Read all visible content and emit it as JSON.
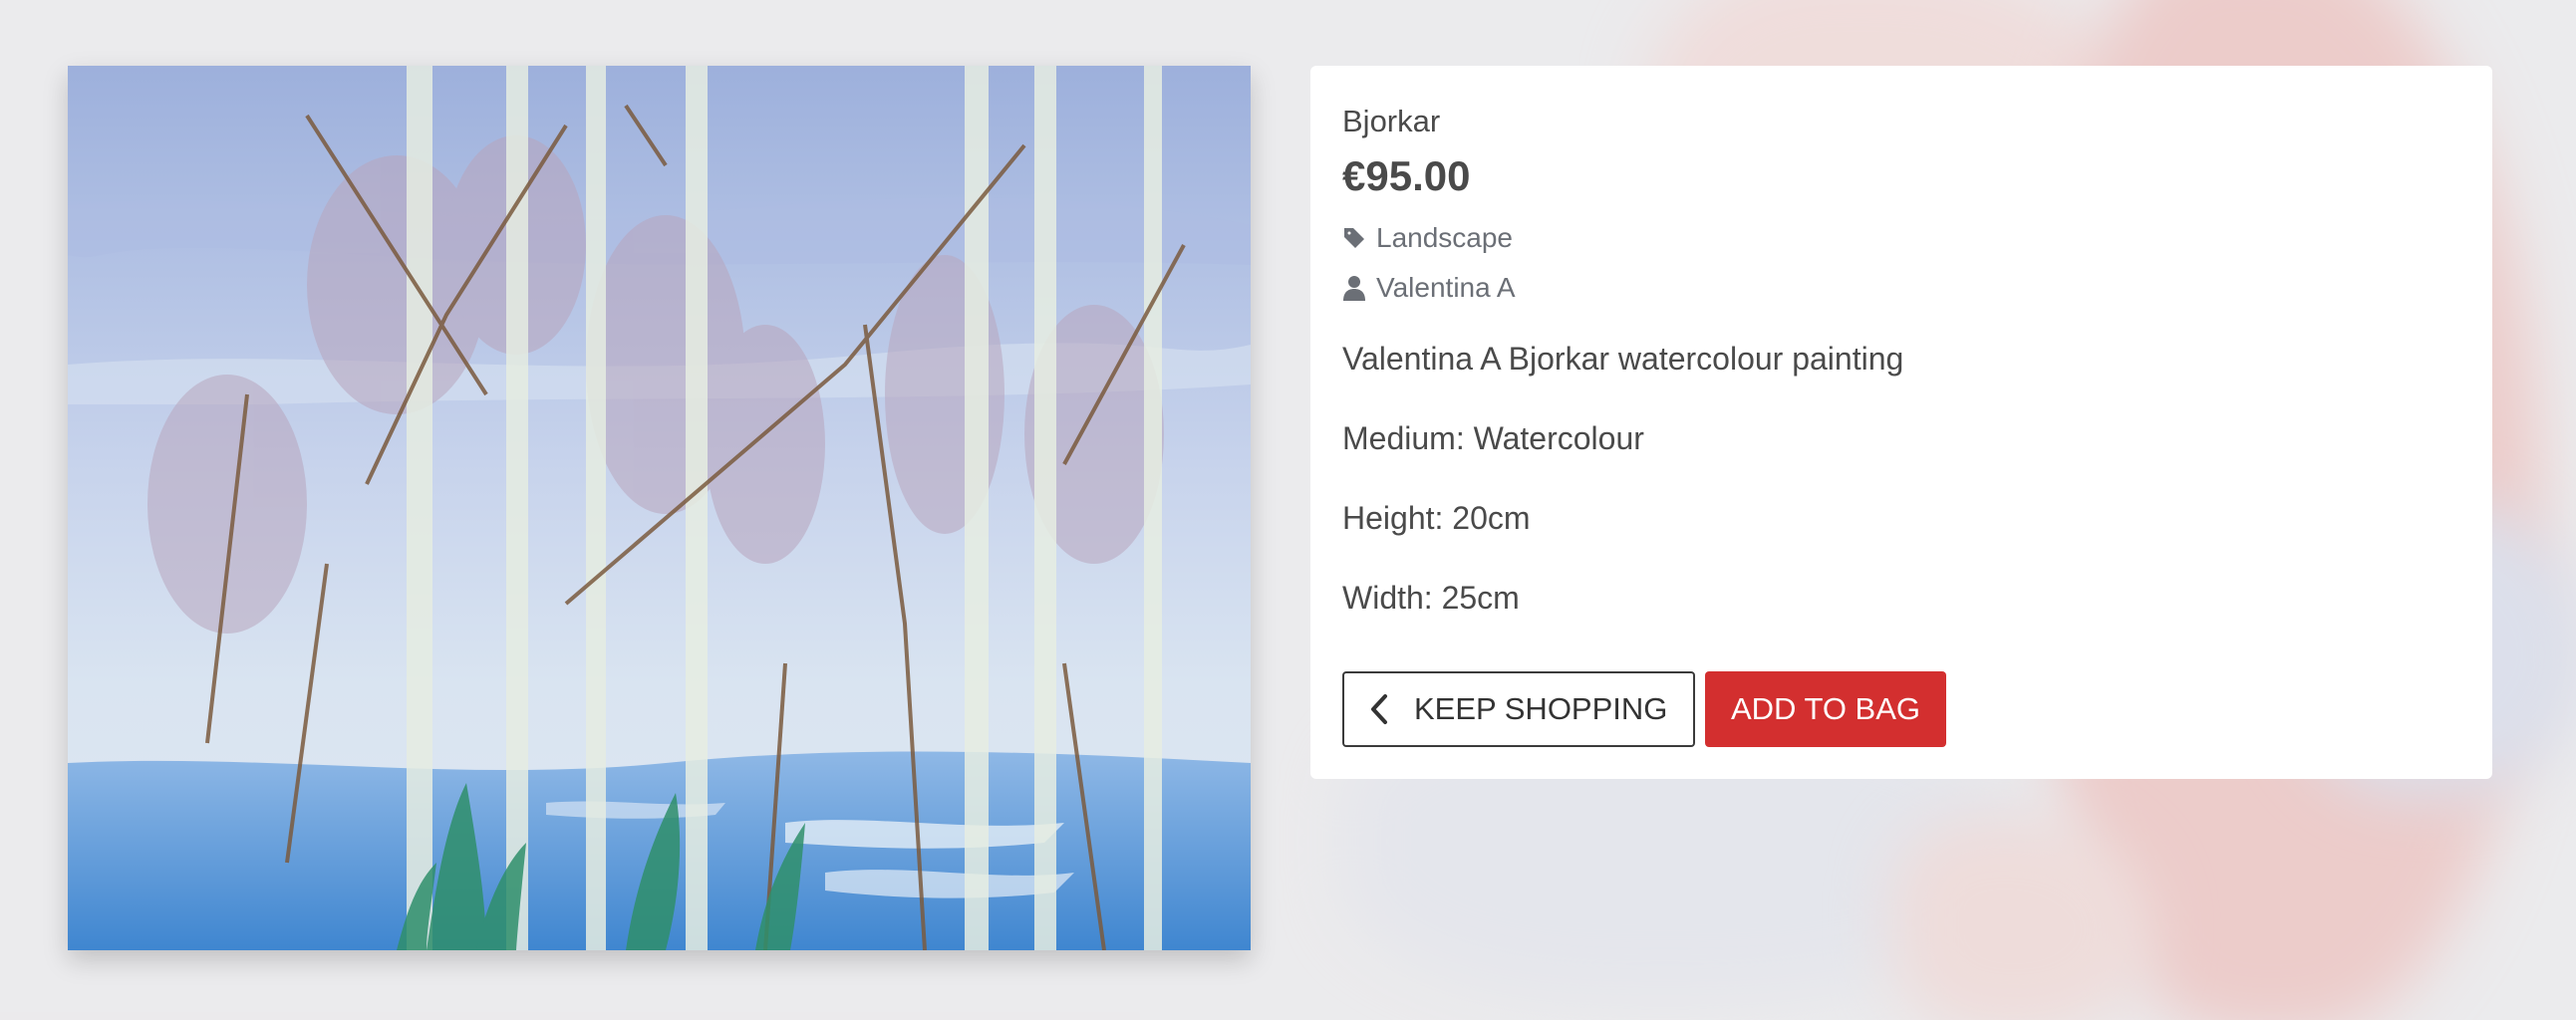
{
  "product": {
    "title": "Bjorkar",
    "price": "€95.00",
    "category": "Landscape",
    "artist": "Valentina A",
    "description": "Valentina A Bjorkar watercolour painting",
    "medium": "Medium: Watercolour",
    "height": "Height: 20cm",
    "width": "Width: 25cm"
  },
  "actions": {
    "keep_shopping_label": "KEEP SHOPPING",
    "add_to_bag_label": "ADD TO BAG"
  },
  "icons": {
    "category": "tag-icon",
    "artist": "user-icon",
    "back": "chevron-left-icon"
  },
  "colors": {
    "add_to_bag": "#d32f2f",
    "text": "#4a4a4a",
    "meta_text": "#6b6f76"
  }
}
